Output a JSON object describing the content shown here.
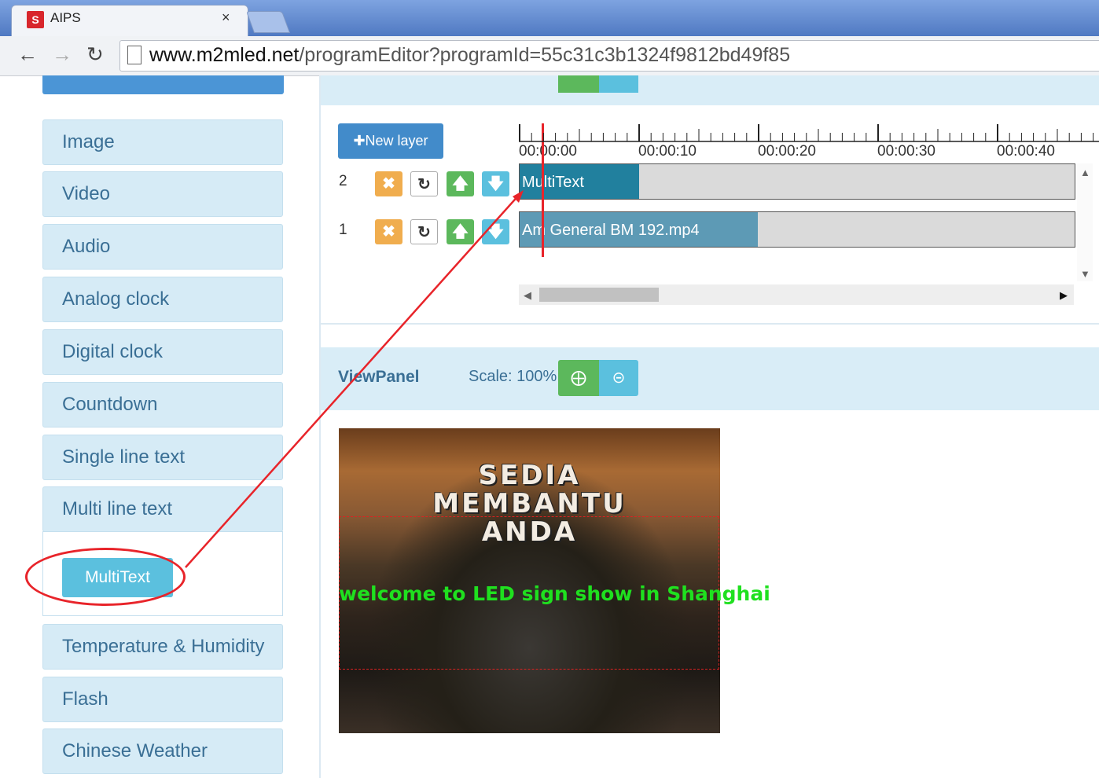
{
  "browser": {
    "tab_title": "AIPS",
    "tab_close": "×",
    "url_domain": "www.m2mled.net",
    "url_path": "/programEditor?programId=55c31c3b1324f9812bd49f85"
  },
  "sidebar": {
    "items": [
      {
        "label": "Image"
      },
      {
        "label": "Video"
      },
      {
        "label": "Audio"
      },
      {
        "label": "Analog clock"
      },
      {
        "label": "Digital clock"
      },
      {
        "label": "Countdown"
      },
      {
        "label": "Single line text"
      },
      {
        "label": "Multi line text"
      },
      {
        "label": "Temperature & Humidity"
      },
      {
        "label": "Flash"
      },
      {
        "label": "Chinese Weather"
      }
    ],
    "expanded_button": "MultiText"
  },
  "timeline": {
    "new_layer_label": "New layer",
    "ticks": [
      "00:00:00",
      "00:00:10",
      "00:00:20",
      "00:00:30",
      "00:00:40"
    ],
    "layers": [
      {
        "num": "2",
        "clip": "MultiText",
        "clip_color": "#21809e"
      },
      {
        "num": "1",
        "clip": "Am General BM 192.mp4",
        "clip_color": "#5d9ab5"
      }
    ]
  },
  "viewpanel": {
    "title": "ViewPanel",
    "scale": "Scale: 100%"
  },
  "preview": {
    "line1": "SEDIA",
    "line2": "MEMBANTU",
    "line3": "ANDA",
    "scroll_text": "welcome to LED sign show in Shanghai"
  },
  "colors": {
    "annotation": "#e8242a",
    "accent_blue": "#428bca",
    "sidebar_bg": "#d6ebf6"
  }
}
